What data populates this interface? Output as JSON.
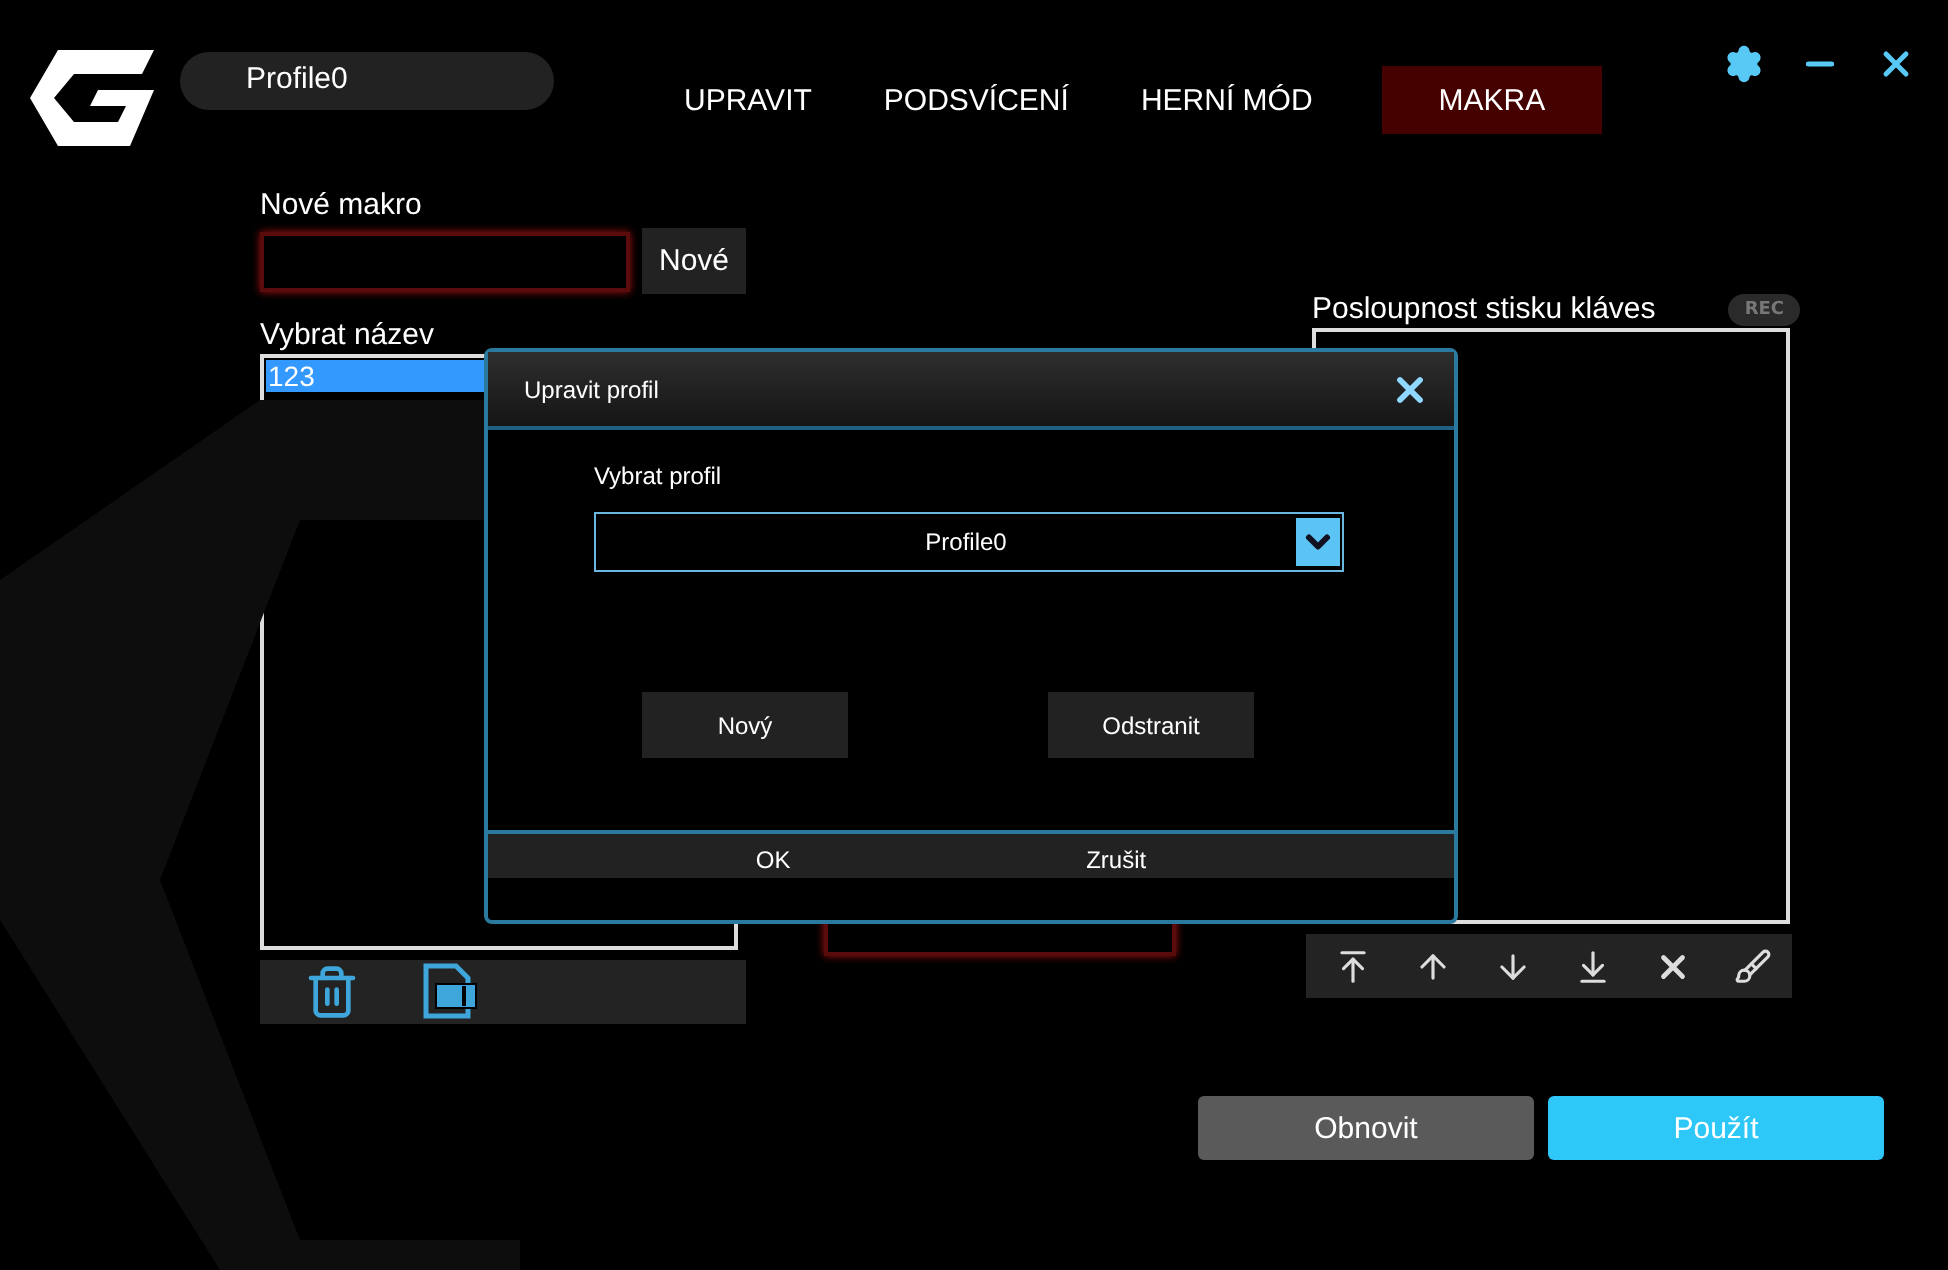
{
  "app": {
    "profile_name": "Profile0"
  },
  "tabs": [
    {
      "label": "UPRAVIT",
      "selected": false
    },
    {
      "label": "PODSVÍCENÍ",
      "selected": false
    },
    {
      "label": "HERNÍ MÓD",
      "selected": false
    },
    {
      "label": "MAKRA",
      "selected": true
    }
  ],
  "new_macro": {
    "label": "Nové makro",
    "button": "Nové"
  },
  "macro_list": {
    "label": "Vybrat název",
    "items": [
      {
        "label": "123",
        "selected": true
      }
    ]
  },
  "key_sequence": {
    "label": "Posloupnost stisku kláves",
    "rec_badge": "REC"
  },
  "buttons": [
    {
      "label": "Obnovit",
      "kind": "secondary"
    },
    {
      "label": "Použít",
      "kind": "primary"
    }
  ],
  "dialog": {
    "title": "Upravit profil",
    "select_label": "Vybrat profil",
    "select_value": "Profile0",
    "buttons": [
      "Nový",
      "Odstranit"
    ],
    "footer_buttons": [
      "OK",
      "Zrušit"
    ]
  }
}
